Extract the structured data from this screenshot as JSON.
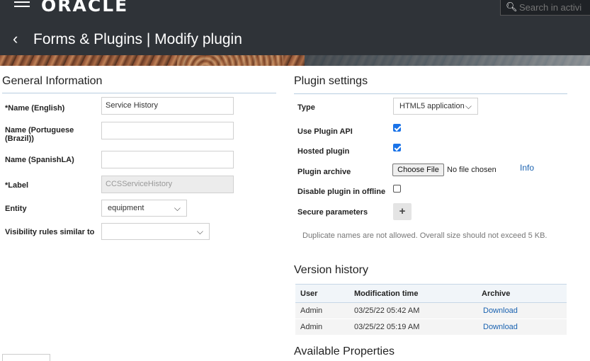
{
  "header": {
    "logo": "ORACLE",
    "search_placeholder": "Search in activi",
    "back_glyph": "‹",
    "title": "Forms & Plugins |  Modify plugin"
  },
  "general": {
    "title": "General Information",
    "name_en_label": "*Name (English)",
    "name_en_value": "Service History",
    "name_pt_label": "Name (Portuguese (Brazil))",
    "name_pt_value": "",
    "name_es_label": "Name (SpanishLA)",
    "name_es_value": "",
    "label_label": "*Label",
    "label_value": "CCSServiceHistory",
    "entity_label": "Entity",
    "entity_value": "equipment",
    "visibility_label": "Visibility rules similar to",
    "visibility_value": ""
  },
  "plugin_settings": {
    "title": "Plugin settings",
    "type_label": "Type",
    "type_value": "HTML5 application",
    "use_api_label": "Use Plugin API",
    "use_api_checked": true,
    "hosted_label": "Hosted plugin",
    "hosted_checked": true,
    "archive_label": "Plugin archive",
    "choose_file": "Choose File",
    "no_file": "No file chosen",
    "info": "Info",
    "disable_offline_label": "Disable plugin in offline",
    "disable_offline_checked": false,
    "secure_label": "Secure parameters",
    "add_glyph": "+",
    "note": "Duplicate names are not allowed. Overall size should not exceed 5 KB."
  },
  "version_history": {
    "title": "Version history",
    "columns": [
      "User",
      "Modification time",
      "Archive"
    ],
    "rows": [
      {
        "user": "Admin",
        "time": "03/25/22 05:42 AM",
        "archive": "Download"
      },
      {
        "user": "Admin",
        "time": "03/25/22 05:19 AM",
        "archive": "Download"
      }
    ]
  },
  "available_properties": {
    "title": "Available Properties"
  },
  "colors": {
    "header_bg": "#2f3338",
    "link": "#1a62b0",
    "checkbox": "#1a73e8"
  }
}
